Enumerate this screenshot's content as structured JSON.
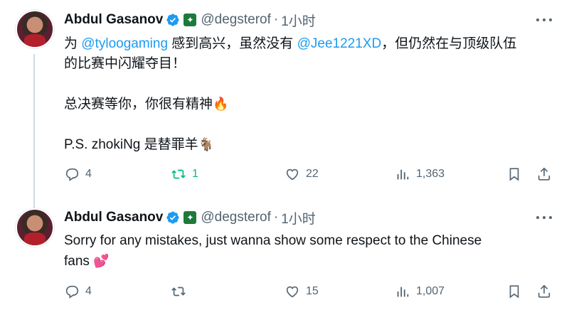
{
  "tweets": [
    {
      "name": "Abdul Gasanov",
      "handle": "@degsterof",
      "dot": "·",
      "time": "1小时",
      "line1_prefix": "为 ",
      "mention1": "@tyloogaming",
      "line1_mid": " 感到高兴，虽然没有 ",
      "mention2": "@Jee1221XD",
      "line1_suffix": "，但仍然在与顶级队伍",
      "line2": "的比赛中闪耀夺目！",
      "line3": "总决赛等你，你很有精神",
      "line3_emoji": "🔥",
      "line4": "P.S. zhokiNg 是替罪羊",
      "line4_emoji": "🐐",
      "replies": "4",
      "reposts": "1",
      "likes": "22",
      "views": "1,363"
    },
    {
      "name": "Abdul Gasanov",
      "handle": "@degsterof",
      "dot": "·",
      "time": "1小时",
      "line1": "Sorry for any mistakes, just wanna show some respect to the Chinese",
      "line2": "fans",
      "line2_emoji": "💕",
      "replies": "4",
      "reposts": "",
      "likes": "15",
      "views": "1,007"
    }
  ],
  "colors": {
    "accent": "#1d9bf0",
    "repost_active": "#00ba7c",
    "muted": "#536471"
  },
  "icons": [
    "verified-badge-icon",
    "affiliate-badge-icon",
    "more-icon",
    "reply-icon",
    "repost-icon",
    "like-icon",
    "views-icon",
    "bookmark-icon",
    "share-icon"
  ]
}
